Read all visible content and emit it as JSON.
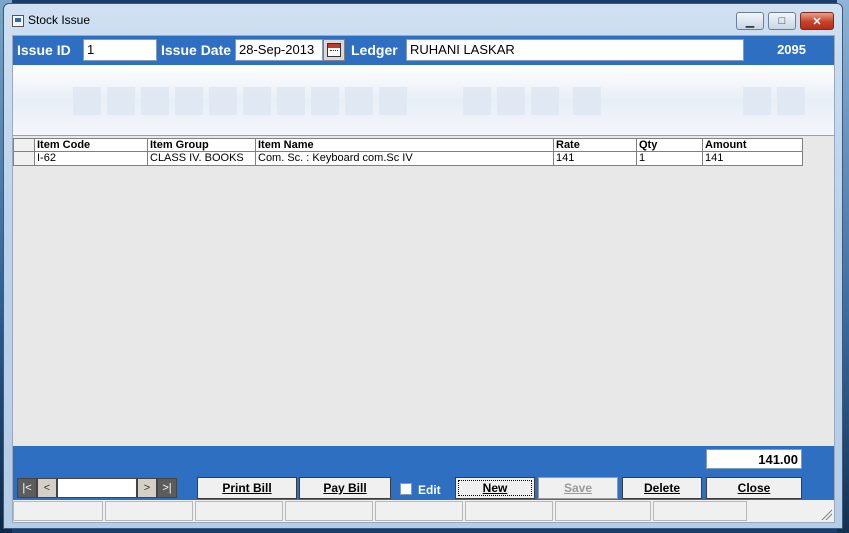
{
  "window": {
    "title": "Stock Issue"
  },
  "header": {
    "issue_id_label": "Issue ID",
    "issue_id_value": "1",
    "issue_date_label": "Issue Date",
    "issue_date_value": "28-Sep-2013",
    "ledger_label": "Ledger",
    "ledger_value": "RUHANI LASKAR",
    "number": "2095"
  },
  "grid": {
    "columns": [
      "Item Code",
      "Item Group",
      "Item Name",
      "Rate",
      "Qty",
      "Amount"
    ],
    "rows": [
      [
        "I-62",
        "CLASS IV. BOOKS",
        "Com. Sc. : Keyboard com.Sc IV",
        "141",
        "1",
        "141"
      ]
    ]
  },
  "footer": {
    "total": "141.00",
    "nav": {
      "first": "|<",
      "prev": "<",
      "next": ">",
      "last": ">|"
    },
    "buttons": {
      "print_bill": "Print Bill",
      "pay_bill": "Pay Bill",
      "edit": "Edit",
      "new": "New",
      "save": "Save",
      "delete": "Delete",
      "close": "Close"
    }
  },
  "colors": {
    "accent": "#2e6fc1"
  }
}
